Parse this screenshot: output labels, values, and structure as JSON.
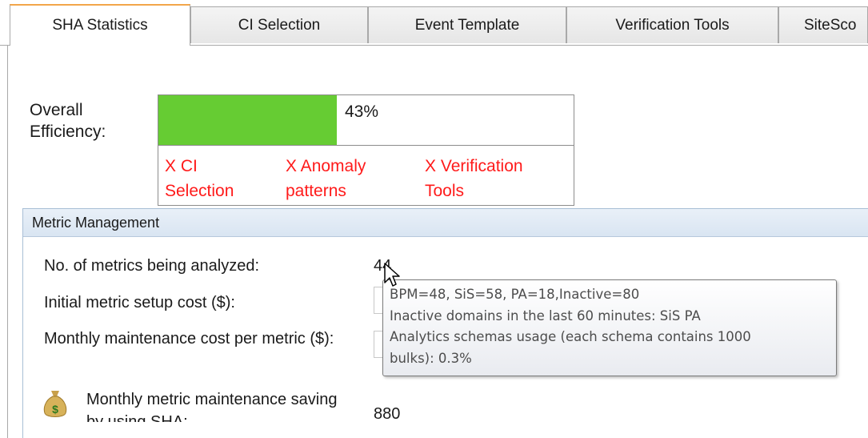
{
  "tabs": [
    {
      "label": "SHA Statistics",
      "active": true
    },
    {
      "label": "CI Selection",
      "active": false
    },
    {
      "label": "Event Template",
      "active": false
    },
    {
      "label": "Verification Tools",
      "active": false
    },
    {
      "label": "SiteSco",
      "active": false
    }
  ],
  "efficiency": {
    "label": "Overall Efficiency:",
    "percent_text": "43%",
    "percent_value": 43,
    "fill_color": "#66cc33",
    "factors": [
      "X CI Selection",
      "X Anomaly patterns",
      "X Verification Tools"
    ],
    "factor_color": "#ff1a1a"
  },
  "metric_management": {
    "title": "Metric Management",
    "rows": [
      {
        "label": "No. of metrics being analyzed:",
        "value": "44"
      },
      {
        "label": "Initial metric setup cost ($):",
        "value": ""
      },
      {
        "label": "Monthly maintenance cost per metric ($):",
        "value": ""
      },
      {
        "label": "Monthly metric maintenance saving by using SHA:",
        "value": "880",
        "icon": "money-bag-icon"
      }
    ]
  },
  "tooltip": {
    "lines": [
      "BPM=48, SiS=58, PA=18,Inactive=80",
      "Inactive domains in the last 60 minutes: SiS PA",
      "Analytics schemas usage (each schema contains 1000",
      "bulks): 0.3%"
    ]
  },
  "cursor_icon": "arrow-cursor-icon"
}
